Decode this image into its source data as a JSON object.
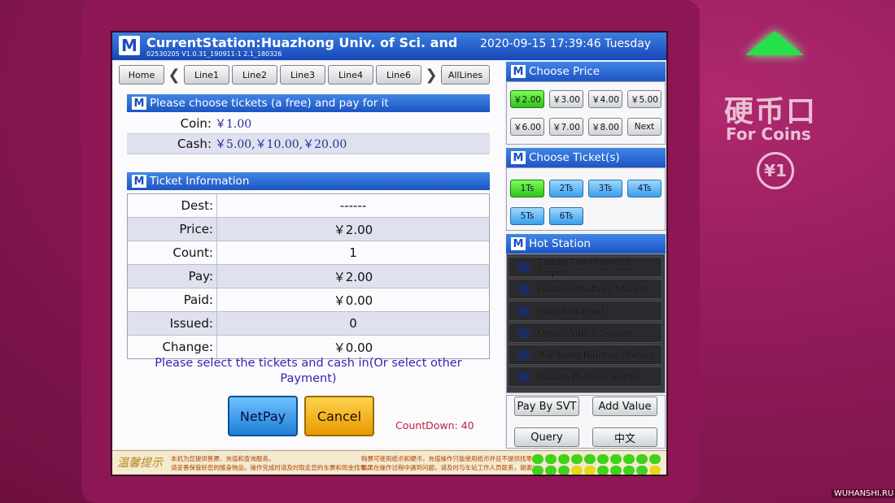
{
  "header": {
    "logo": "M",
    "station": "CurrentStation:Huazhong Univ. of Sci. and",
    "version": "02530205 V1.0.31_190911-1 2.1_180326",
    "datetime": "2020-09-15   17:39:46   Tuesday"
  },
  "nav": {
    "home": "Home",
    "prev": "❮",
    "next": "❯",
    "lines": [
      "Line1",
      "Line2",
      "Line3",
      "Line4",
      "Line6"
    ],
    "all": "AllLines"
  },
  "payment": {
    "heading": "Please choose tickets (a free) and pay for it",
    "coin_label": "Coin:",
    "coin_value": "￥1.00",
    "cash_label": "Cash:",
    "cash_value": "￥5.00,￥10.00,￥20.00"
  },
  "ticket_info": {
    "heading": "Ticket Information",
    "rows": [
      {
        "label": "Dest:",
        "value": "------"
      },
      {
        "label": "Price:",
        "value": "￥2.00"
      },
      {
        "label": "Count:",
        "value": "1"
      },
      {
        "label": "Pay:",
        "value": "￥2.00"
      },
      {
        "label": "Paid:",
        "value": "￥0.00"
      },
      {
        "label": "Issued:",
        "value": "0"
      },
      {
        "label": "Change:",
        "value": "￥0.00"
      }
    ]
  },
  "hint": "Please select the tickets and cash in(Or select other Payment)",
  "actions": {
    "netpay": "NetPay",
    "cancel": "Cancel"
  },
  "countdown": "CountDown:  40",
  "choose_price": {
    "heading": "Choose Price",
    "options": [
      "￥2.00",
      "￥3.00",
      "￥4.00",
      "￥5.00",
      "￥6.00",
      "￥7.00",
      "￥8.00",
      "Next"
    ],
    "selected": "￥2.00"
  },
  "choose_tickets": {
    "heading": "Choose Ticket(s)",
    "options": [
      "1Ts",
      "2Ts",
      "3Ts",
      "4Ts",
      "5Ts",
      "6Ts"
    ],
    "selected": "1Ts"
  },
  "hot_station": {
    "heading": "Hot Station",
    "items": [
      "Tianhe International Airport",
      "Hankou Railway Station",
      "Jianghan Road",
      "Optics Valley Square",
      "Wuchang Railway Station",
      "Wuhan Railway Station"
    ]
  },
  "services": {
    "svt": "Pay By SVT",
    "add_value": "Add Value",
    "query": "Query",
    "language": "中文"
  },
  "footer": {
    "label": "温馨提示",
    "text_left_1": "本机为您提供售票、充值和查询服务。",
    "text_left_2": "请妥善保管好您的随身物品，操作完成时请及时取走您的车票和现金找零。",
    "text_right_1": "购票可使用纸币和硬币，充值操作只能使用纸币并且不提供找零。",
    "text_right_2": "如果在操作过程中遇到问题，请及时与车站工作人员联系，谢谢！"
  },
  "machine": {
    "coin_slot_cn": "硬币口",
    "coin_slot_en": "For Coins",
    "coin_value": "¥1"
  },
  "watermark": "WUHANSHI.RU"
}
